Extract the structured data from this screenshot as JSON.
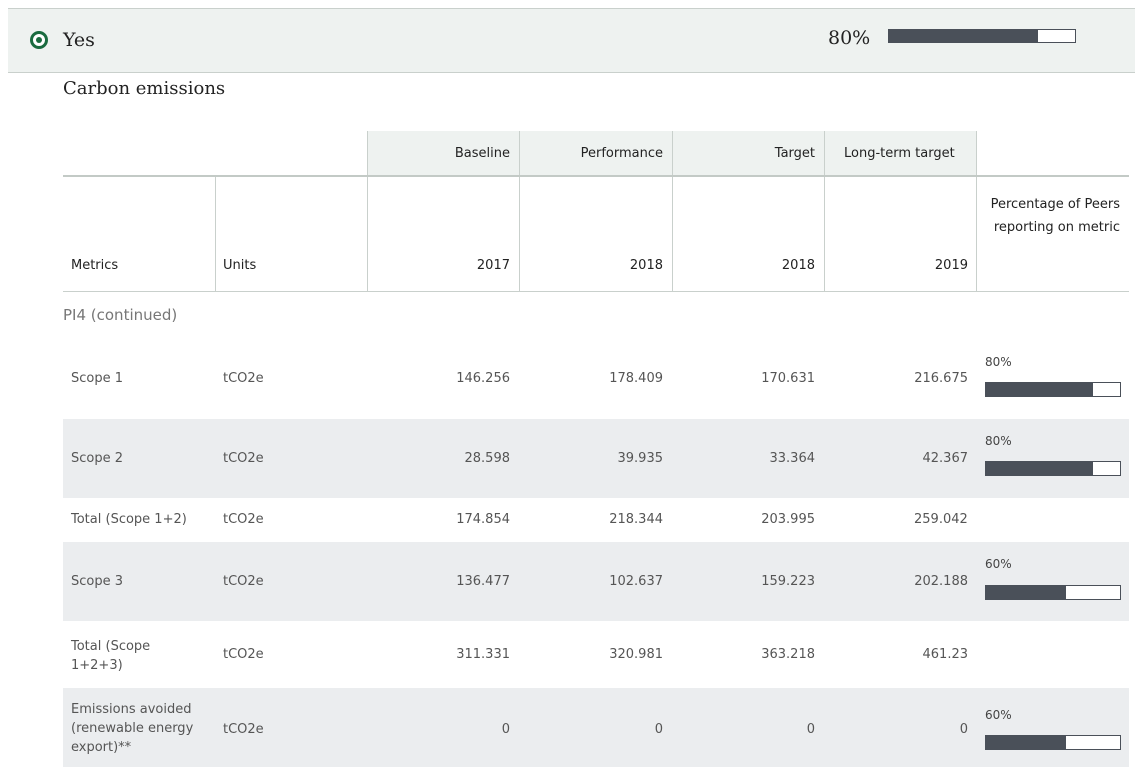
{
  "answer": {
    "label": "Yes",
    "percent_text": "80%",
    "percent_value": 0.8
  },
  "section_title": "Carbon emissions",
  "table": {
    "group_headers": [
      "Baseline",
      "Performance",
      "Target",
      "Long-term target"
    ],
    "columns": [
      "Metrics",
      "Units",
      "2017",
      "2018",
      "2018",
      "2019",
      "Percentage of Peers reporting on metric"
    ],
    "subsection": "PI4 (continued)",
    "rows": [
      {
        "metric": "Scope 1",
        "unit": "tCO2e",
        "v2017": "146.256",
        "v2018p": "178.409",
        "v2018t": "170.631",
        "v2019": "216.675",
        "pct": "80%",
        "pct_value": 0.8
      },
      {
        "metric": "Scope 2",
        "unit": "tCO2e",
        "v2017": "28.598",
        "v2018p": "39.935",
        "v2018t": "33.364",
        "v2019": "42.367",
        "pct": "80%",
        "pct_value": 0.8
      },
      {
        "metric": "Total (Scope 1+2)",
        "unit": "tCO2e",
        "v2017": "174.854",
        "v2018p": "218.344",
        "v2018t": "203.995",
        "v2019": "259.042"
      },
      {
        "metric": "Scope 3",
        "unit": "tCO2e",
        "v2017": "136.477",
        "v2018p": "102.637",
        "v2018t": "159.223",
        "v2019": "202.188",
        "pct": "60%",
        "pct_value": 0.6
      },
      {
        "metric": "Total (Scope 1+2+3)",
        "unit": "tCO2e",
        "v2017": "311.331",
        "v2018p": "320.981",
        "v2018t": "363.218",
        "v2019": "461.23"
      },
      {
        "metric": "Emissions avoided (renewable energy export)**",
        "unit": "tCO2e",
        "v2017": "0",
        "v2018p": "0",
        "v2018t": "0",
        "v2019": "0",
        "pct": "60%",
        "pct_value": 0.6
      }
    ]
  },
  "colors": {
    "accent": "#1a6b3f",
    "bar": "#4a5059",
    "header_bg": "#eef2f0",
    "row_alt": "#ebedef"
  }
}
